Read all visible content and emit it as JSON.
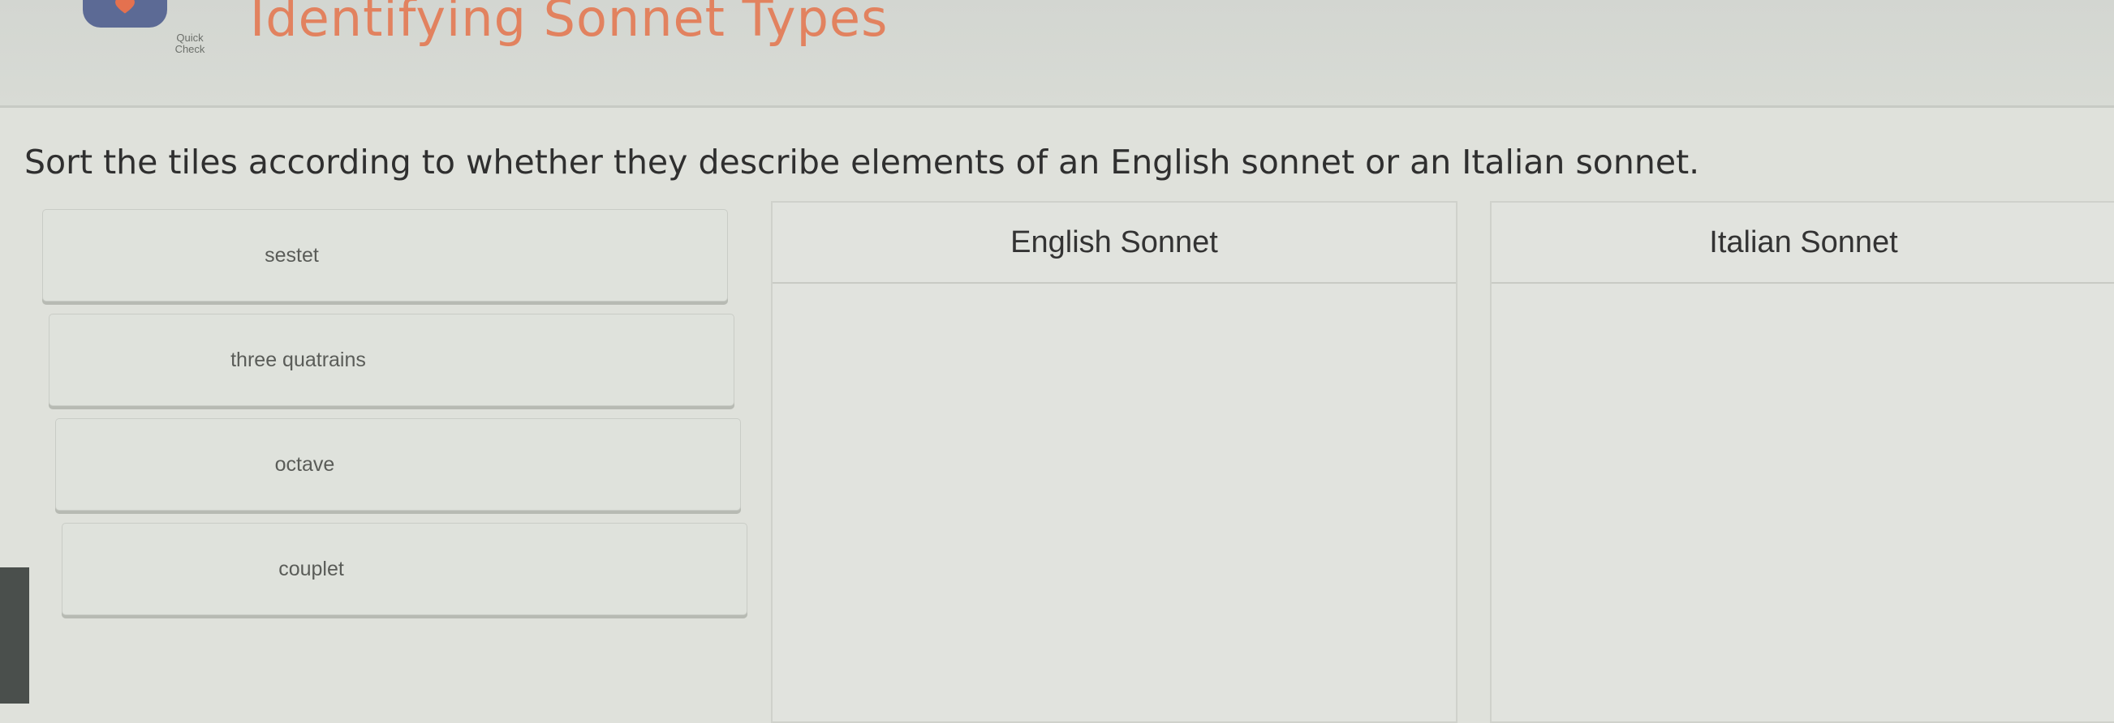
{
  "header": {
    "logo_line1": "Quick",
    "logo_line2": "Check",
    "title": "Identifying Sonnet Types"
  },
  "instruction": "Sort the tiles according to whether they describe elements of an English sonnet or an Italian sonnet.",
  "tiles": [
    {
      "label": "sestet"
    },
    {
      "label": "three quatrains"
    },
    {
      "label": "octave"
    },
    {
      "label": "couplet"
    }
  ],
  "bins": [
    {
      "label": "English Sonnet"
    },
    {
      "label": "Italian Sonnet"
    }
  ],
  "colors": {
    "title": "#e2825f",
    "logo": "#5c6a95",
    "heart": "#e4714f"
  }
}
